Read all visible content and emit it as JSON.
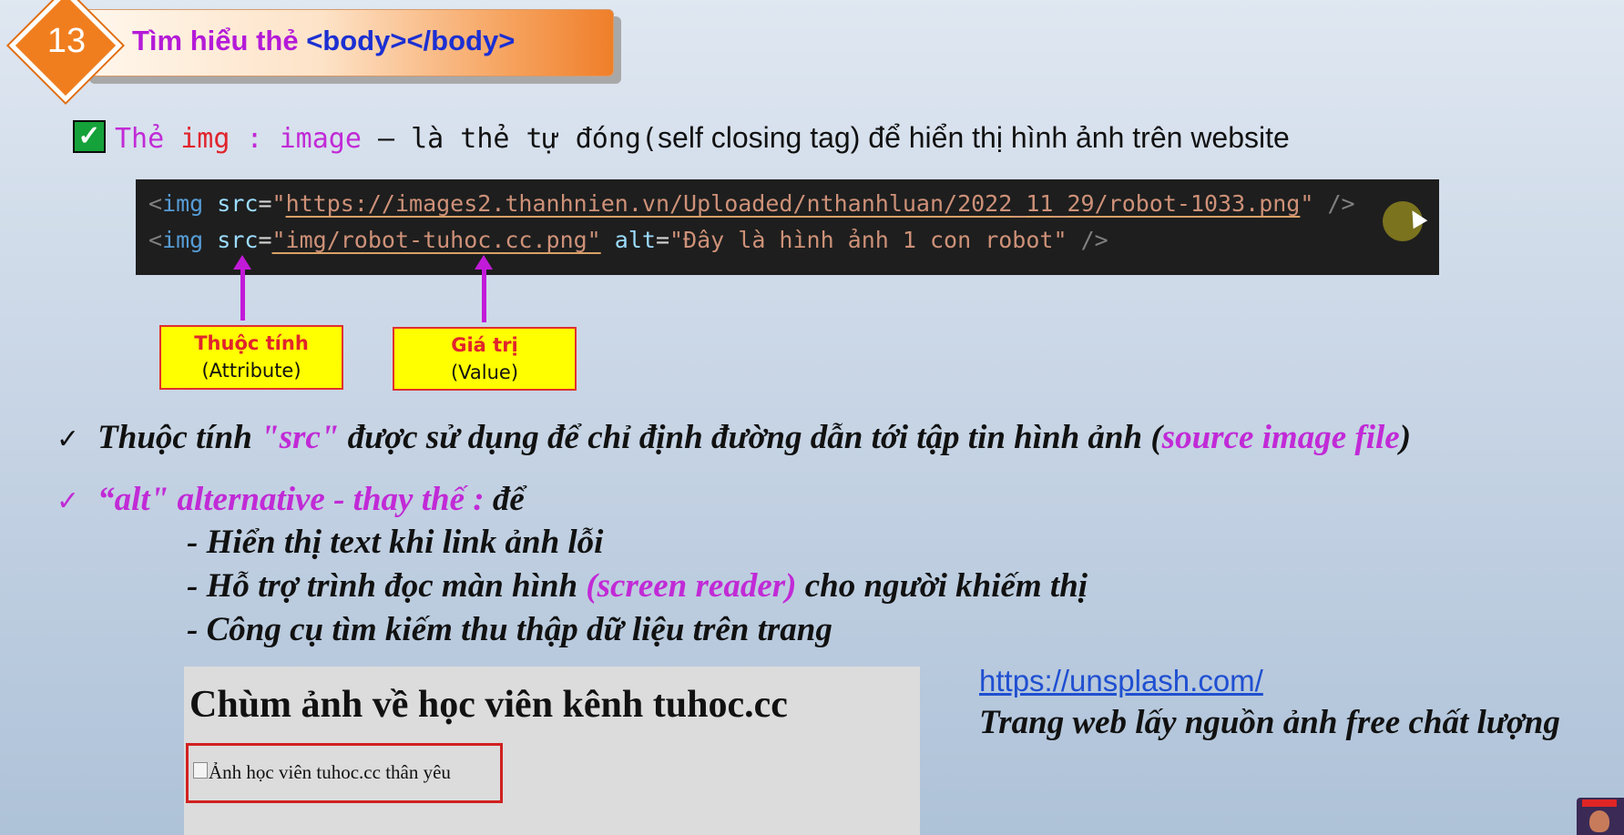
{
  "header": {
    "number": "13",
    "title_prefix": "Tìm hiểu thẻ ",
    "title_tag": "<body></body>"
  },
  "intro": {
    "check_glyph": "✓",
    "part1": "Thẻ ",
    "part2": "img",
    "part3": " : ",
    "part4": "image",
    "part5": " – là thẻ tự đóng(",
    "part6": "self closing tag) để hiển thị hình ảnh trên website"
  },
  "code": {
    "line1": {
      "open": "<",
      "tag": "img",
      "attr": " src",
      "eq": "=",
      "q1": "\"",
      "value": "https://images2.thanhnien.vn/Uploaded/nthanhluan/2022_11_29/robot-1033.png",
      "q2": "\"",
      "close": " />"
    },
    "line2": {
      "open": "<",
      "tag": "img",
      "attr1": " src",
      "eq1": "=",
      "value1": "\"img/robot-tuhoc.cc.png\"",
      "attr2": " alt",
      "eq2": "=",
      "value2": "\"Đây là hình ảnh 1 con robot\"",
      "close": " />"
    }
  },
  "labels": {
    "attribute_vi": "Thuộc tính",
    "attribute_en": "(Attribute)",
    "value_vi": "Giá trị",
    "value_en": "(Value)"
  },
  "bullets": {
    "tick": "✓",
    "b1_part1": "Thuộc tính ",
    "b1_part2": "\"src\"",
    "b1_part3": " được sử dụng để chỉ định đường dẫn tới tập tin hình ảnh (",
    "b1_part4": "source image file",
    "b1_part5": ")",
    "b2_part1": "“alt\"  alternative - thay thế : ",
    "b2_part2": "để",
    "sub1": "- Hiển thị text khi link ảnh lỗi",
    "sub2_part1": "- Hỗ trợ trình đọc màn hình ",
    "sub2_part2": "(screen reader)",
    "sub2_part3": " cho người khiếm thị",
    "sub3": "- Công cụ tìm kiếm thu thập dữ liệu trên trang"
  },
  "preview": {
    "heading": "Chùm ảnh về học viên kênh tuhoc.cc",
    "alt_text": "Ảnh học viên tuhoc.cc thân yêu"
  },
  "resource": {
    "link": "https://unsplash.com/",
    "description": "Trang web lấy nguồn ảnh free chất lượng"
  }
}
